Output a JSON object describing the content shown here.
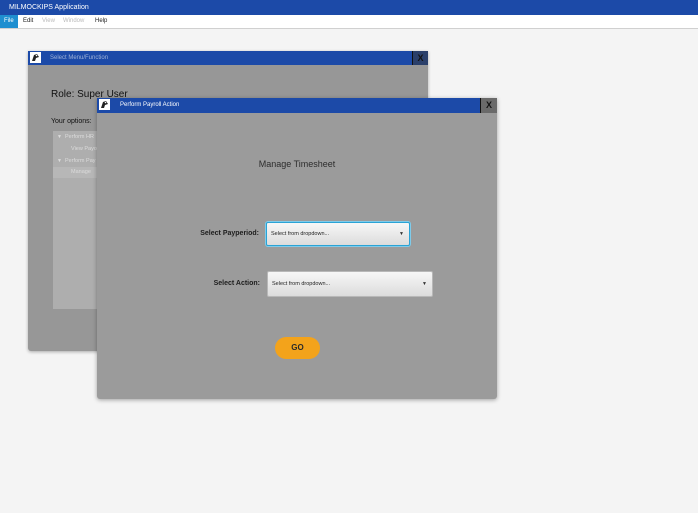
{
  "app": {
    "title": "MILMOCKIPS Application"
  },
  "menu": [
    {
      "label": "File",
      "active": true
    },
    {
      "label": "Edit"
    },
    {
      "label": "View",
      "disabled": true
    },
    {
      "label": "Window",
      "disabled": true
    },
    {
      "label": "Help"
    }
  ],
  "menu_window": {
    "title": "Select Menu/Function",
    "close_label": "X",
    "role_text": "Role:  Super User",
    "options_label": "Your options:",
    "tree": [
      {
        "label": "Perform HR",
        "arrow": "▼"
      },
      {
        "label": "View Payo"
      },
      {
        "label": "Perform Pay",
        "arrow": "▼"
      },
      {
        "label": "Manage"
      }
    ]
  },
  "payroll_window": {
    "title": "Perform Payroll Action",
    "close_label": "X",
    "heading": "Manage Timesheet",
    "payperiod": {
      "label": "Select Payperiod:",
      "value": "Select from dropdown..."
    },
    "action": {
      "label": "Select Action:",
      "value": "Select from dropdown..."
    },
    "go_label": "GO"
  },
  "colors": {
    "titlebar": "#1c4aa8",
    "menu_active": "#1f8fd0",
    "go_button": "#f3a31b",
    "overlay_gray": "#9b9b9b"
  }
}
